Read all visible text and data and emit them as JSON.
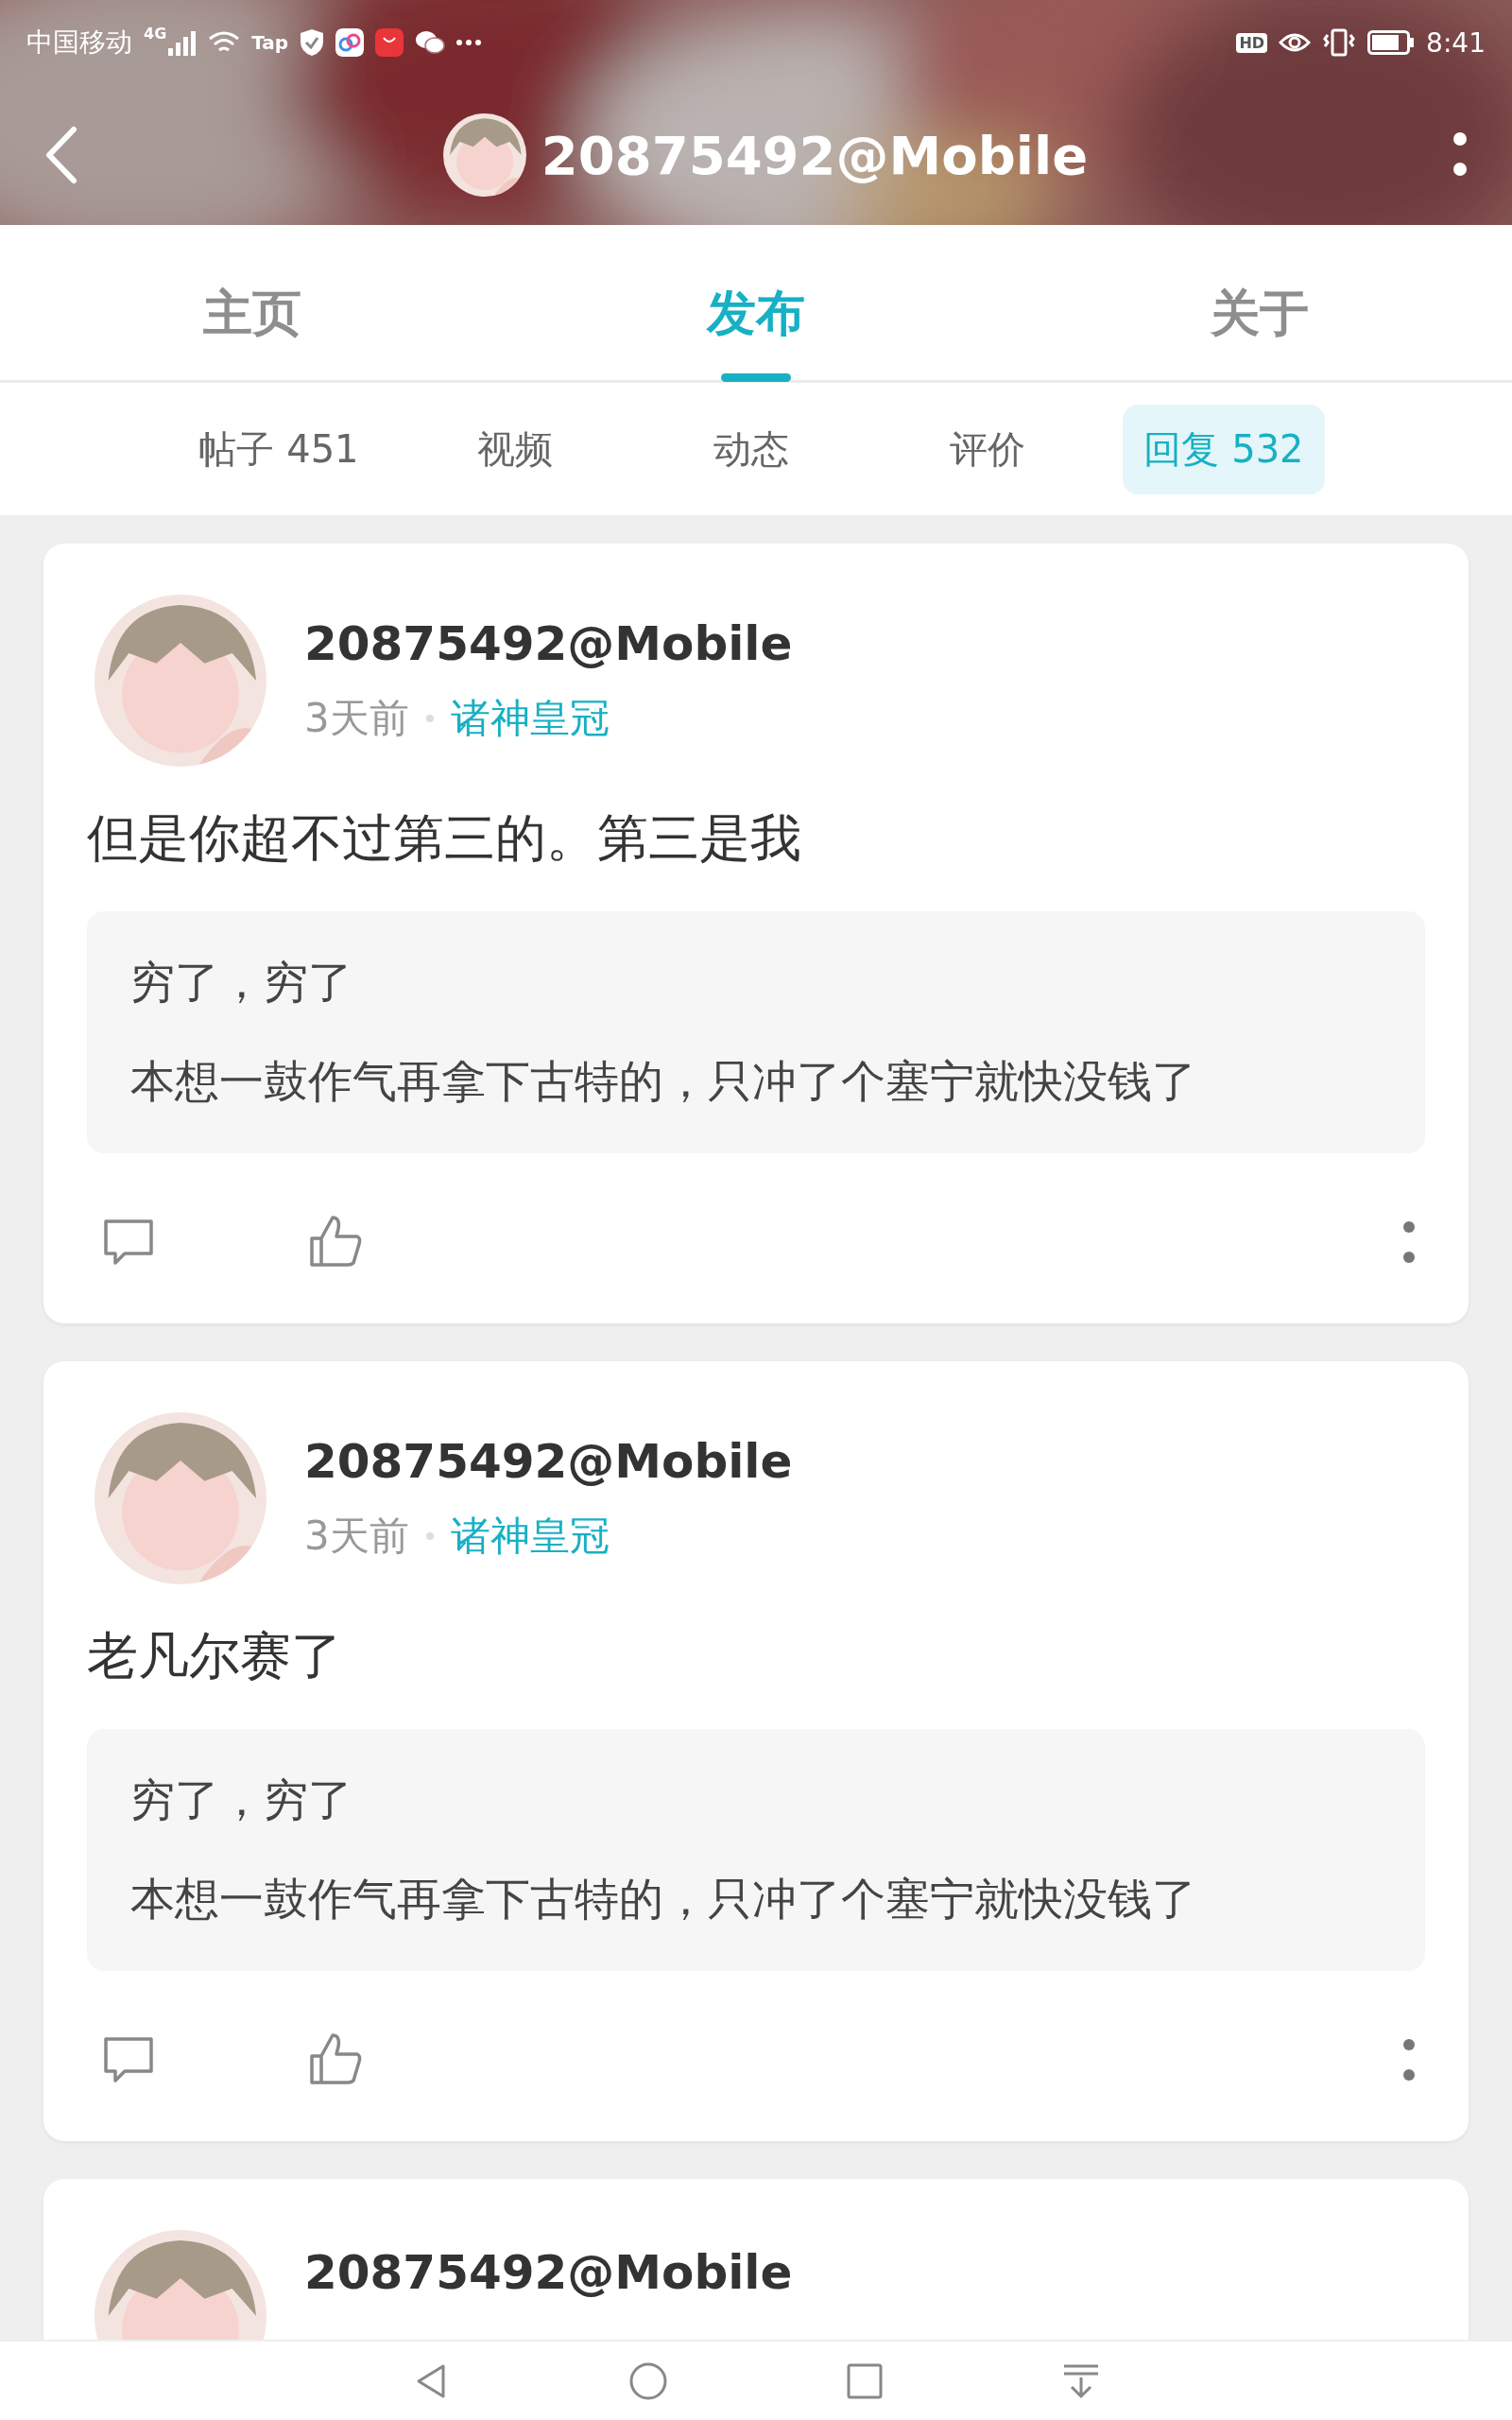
{
  "status_bar": {
    "carrier": "中国移动",
    "network": "4G",
    "tap_label": "Tap",
    "hd_label": "HD",
    "time": "8:41"
  },
  "header": {
    "title": "20875492@Mobile"
  },
  "tabs": [
    {
      "label": "主页",
      "selected": false
    },
    {
      "label": "发布",
      "selected": true
    },
    {
      "label": "关于",
      "selected": false
    }
  ],
  "subtabs": [
    {
      "label": "帖子",
      "count": "451",
      "selected": false
    },
    {
      "label": "视频",
      "selected": false
    },
    {
      "label": "动态",
      "selected": false
    },
    {
      "label": "评价",
      "selected": false
    },
    {
      "label": "回复",
      "count": "532",
      "selected": true
    }
  ],
  "posts": [
    {
      "author": "20875492@Mobile",
      "time": "3天前",
      "forum": "诸神皇冠",
      "text": "但是你超不过第三的。第三是我",
      "quote": [
        "穷了，穷了",
        "本想一鼓作气再拿下古特的，只冲了个塞宁就快没钱了"
      ]
    },
    {
      "author": "20875492@Mobile",
      "time": "3天前",
      "forum": "诸神皇冠",
      "text": "老凡尔赛了",
      "quote": [
        "穷了，穷了",
        "本想一鼓作气再拿下古特的，只冲了个塞宁就快没钱了"
      ]
    },
    {
      "author": "20875492@Mobile"
    }
  ]
}
